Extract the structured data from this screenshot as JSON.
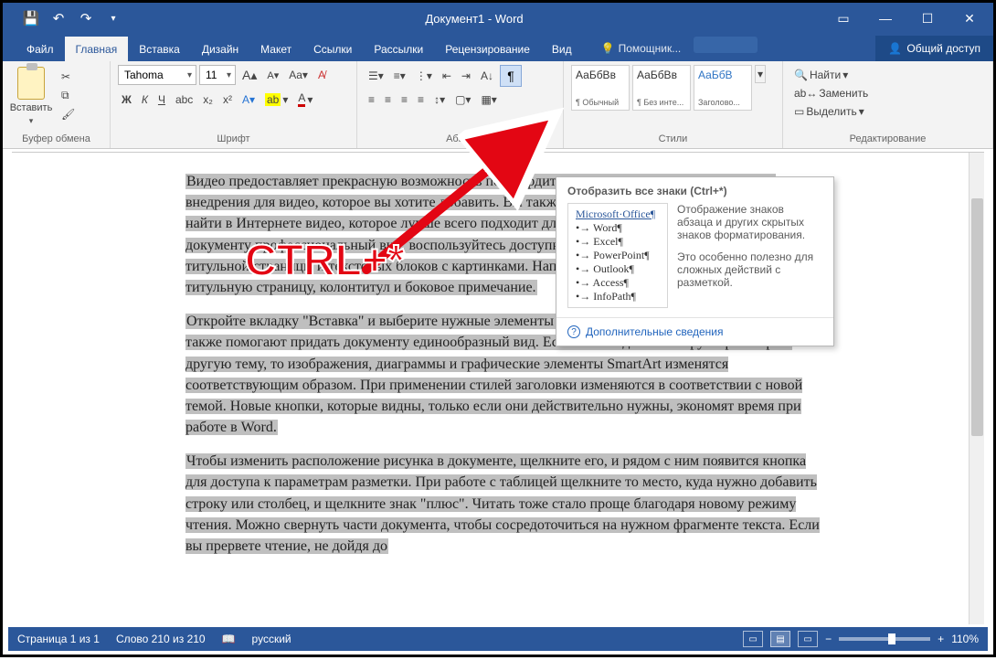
{
  "window_title": "Документ1 - Word",
  "qat": {
    "save": "💾",
    "undo": "↶",
    "redo": "↷"
  },
  "tabs": {
    "file": "Файл",
    "home": "Главная",
    "insert": "Вставка",
    "design": "Дизайн",
    "layout": "Макет",
    "references": "Ссылки",
    "mailings": "Рассылки",
    "review": "Рецензирование",
    "view": "Вид",
    "tellme_placeholder": "Помощник...",
    "share": "Общий доступ"
  },
  "ribbon": {
    "clipboard": {
      "paste": "Вставить",
      "label": "Буфер обмена"
    },
    "font": {
      "name": "Tahoma",
      "size": "11",
      "label": "Шрифт",
      "bold": "Ж",
      "italic": "К",
      "underline": "Ч"
    },
    "paragraph": {
      "label": "Абзац"
    },
    "styles": {
      "label": "Стили",
      "items": [
        {
          "sample": "АаБбВв",
          "name": "¶ Обычный"
        },
        {
          "sample": "АаБбВв",
          "name": "¶ Без инте..."
        },
        {
          "sample": "АаБбВ",
          "name": "Заголово..."
        }
      ]
    },
    "editing": {
      "label": "Редактирование",
      "find": "Найти",
      "replace": "Заменить",
      "select": "Выделить"
    }
  },
  "tooltip": {
    "title": "Отобразить все знаки (Ctrl+*)",
    "list_header": "Microsoft·Office¶",
    "list_items": [
      "Word¶",
      "Excel¶",
      "PowerPoint¶",
      "Outlook¶",
      "Access¶",
      "InfoPath¶"
    ],
    "desc1": "Отображение знаков абзаца и других скрытых знаков форматирования.",
    "desc2": "Это особенно полезно для сложных действий с разметкой.",
    "more": "Дополнительные сведения"
  },
  "document": {
    "p1": "Видео предоставляет   прекрасную возможность подтвердить свою точку зрения и вставить код внедрения для видео, которое вы хотите добавить.  Вы также можете  ввести ключевое слово, чтобы найти в Интернете видео, которое лучше всего подходит для вашего документа. Чтобы придать документу профессиональный вид, воспользуйтесь  доступными коллекциями колонтитулов,  титульной страницы и  текстовых блоков с картинками. Например,   вы можете добавить  подходящую титульную страницу, колонтитул и боковое примечание.",
    "p2": "Откройте вкладку \"Вставка\" и   выберите нужные элементы из   различных коллекций. Темы и стили   также помогают придать документу единообразный вид.   Если на вкладке \"Конструктор\" выбрать другую тему,   то изображения, диаграммы и графические элементы SmartArt   изменятся соответствующим образом.  При применении стилей заголовки изменяются в соответствии    с новой темой. Новые кнопки, которые видны, только если они действительно нужны, экономят время при работе в Word.",
    "p3": "Чтобы изменить расположение рисунка в документе, щелкните его, и рядом с ним появится кнопка для доступа к параметрам разметки. При работе с таблицей щелкните то место, куда нужно добавить строку или столбец, и щелкните знак \"плюс\". Читать тоже стало проще благодаря новому режиму чтения. Можно свернуть части документа, чтобы сосредоточиться на нужном фрагменте текста. Если вы прервете чтение, не дойдя до"
  },
  "statusbar": {
    "page": "Страница 1 из 1",
    "words": "Слово 210 из 210",
    "lang": "русский",
    "zoom": "110%"
  },
  "annotation": "CTRL+*"
}
